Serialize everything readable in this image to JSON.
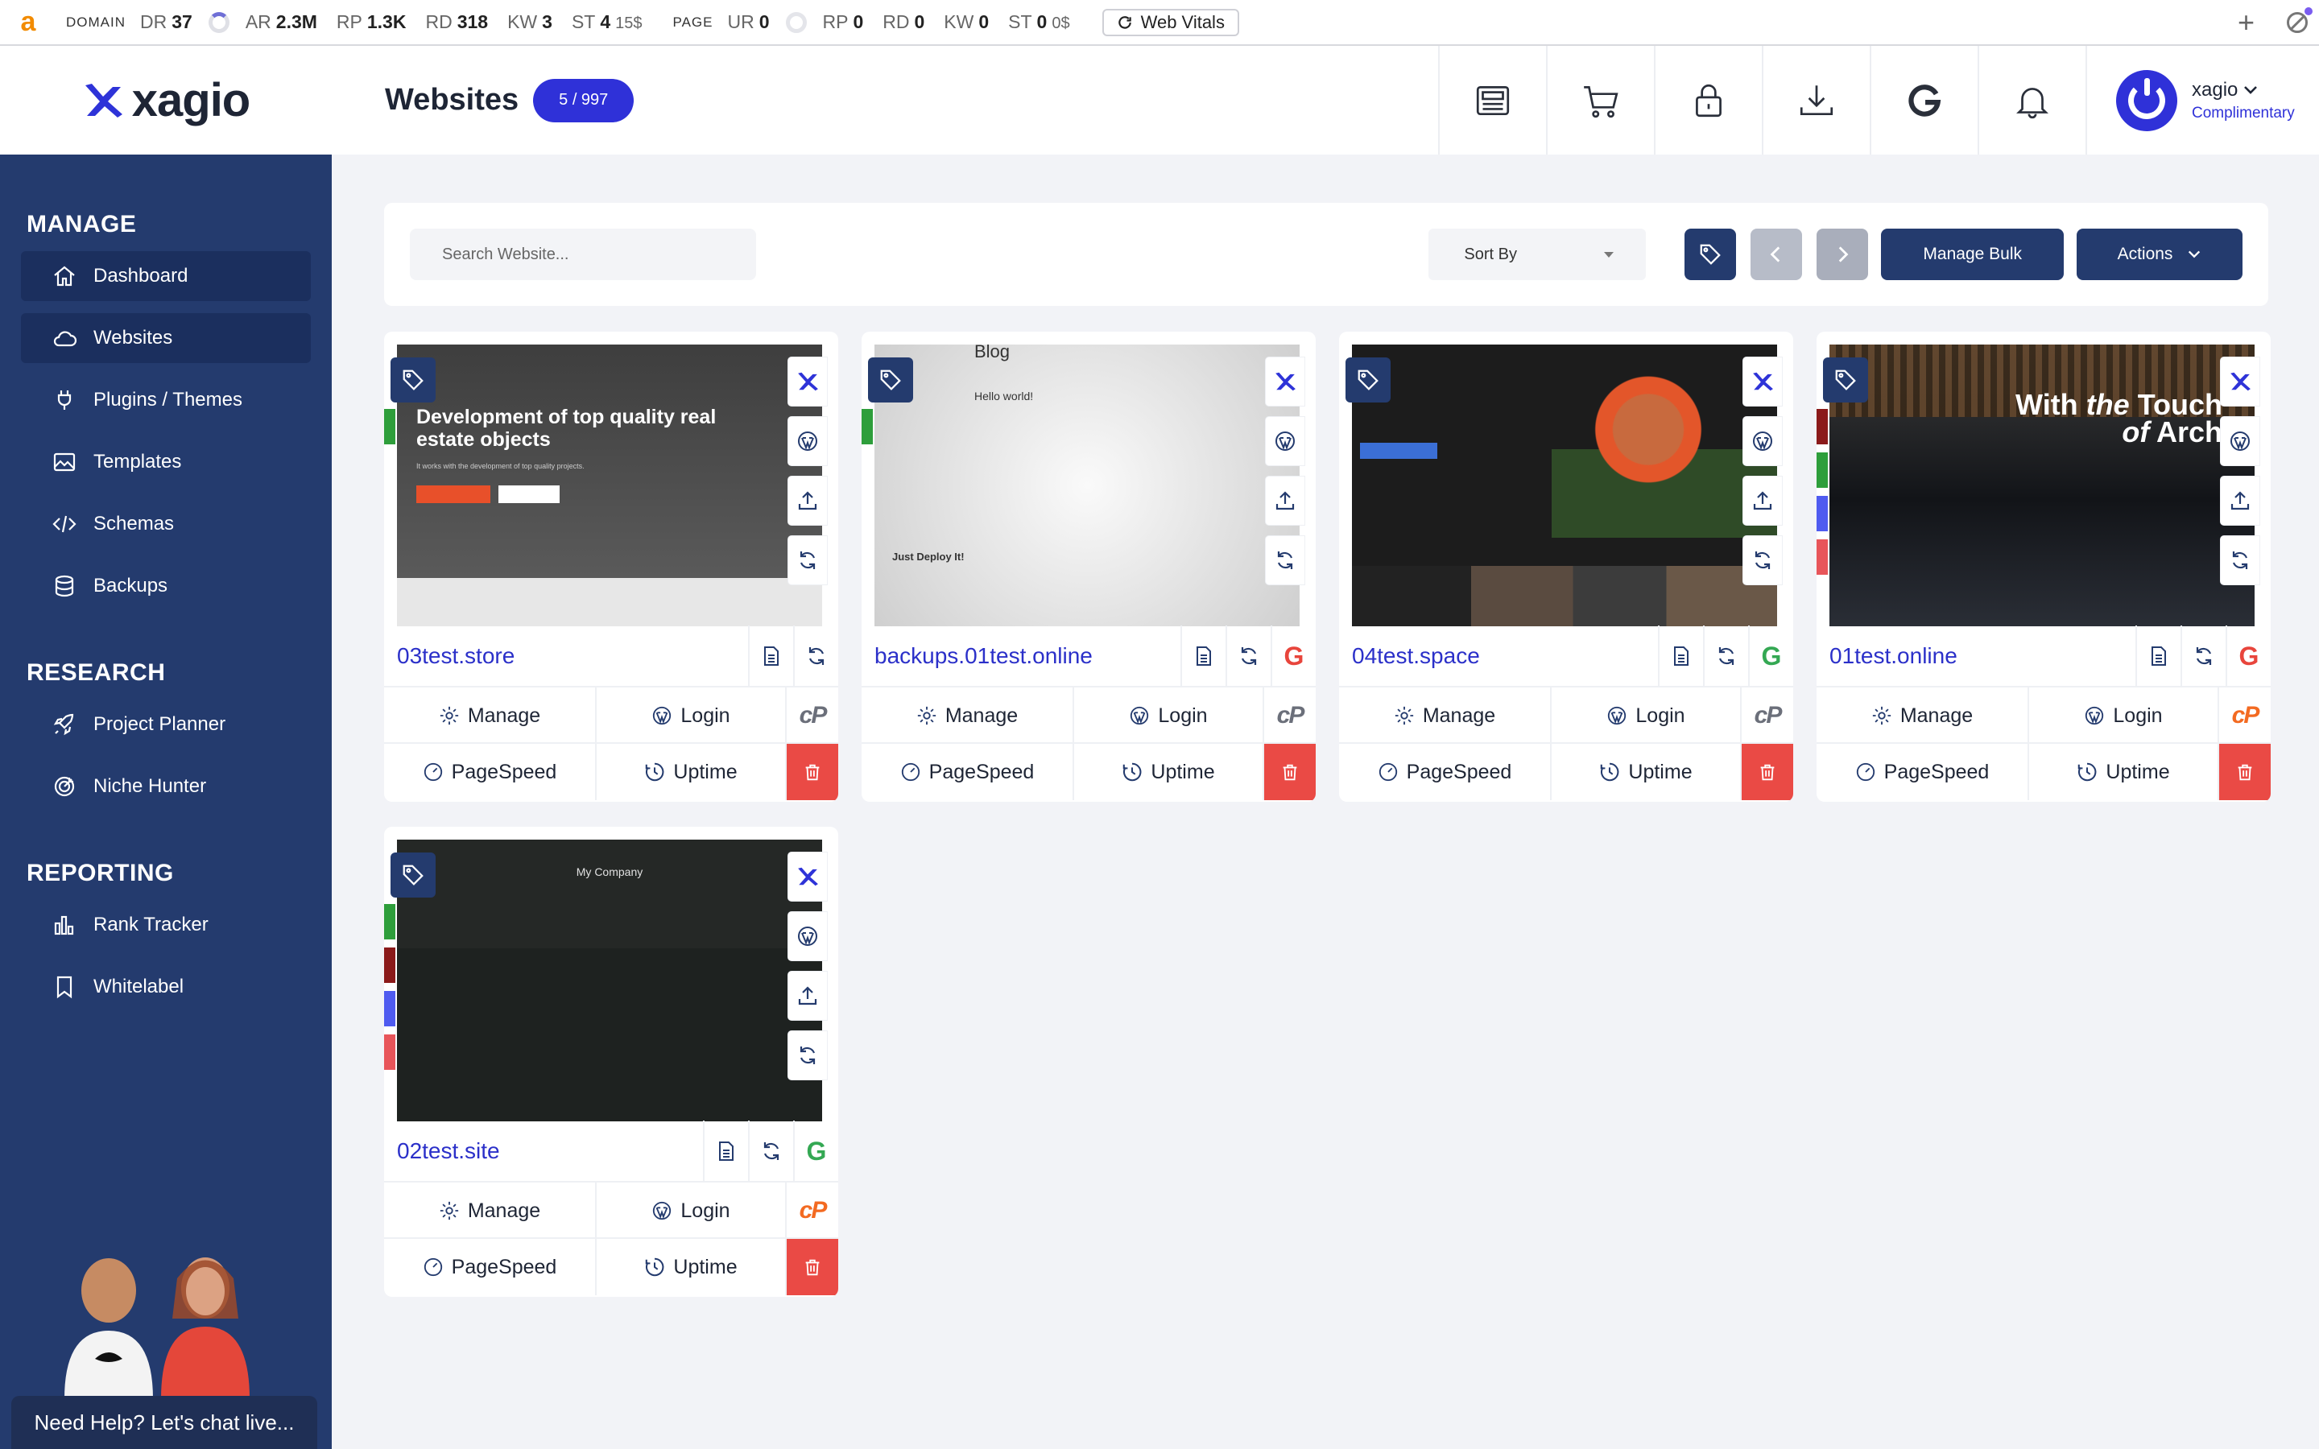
{
  "seo_bar": {
    "logo": "a",
    "domain_label": "DOMAIN",
    "domain_metrics": [
      {
        "k": "DR",
        "v": "37"
      },
      {
        "k": "AR",
        "v": "2.3M"
      },
      {
        "k": "RP",
        "v": "1.3K"
      },
      {
        "k": "RD",
        "v": "318"
      },
      {
        "k": "KW",
        "v": "3"
      },
      {
        "k": "ST",
        "v": "4",
        "u": "15$"
      }
    ],
    "page_label": "PAGE",
    "page_metrics": [
      {
        "k": "UR",
        "v": "0"
      },
      {
        "k": "RP",
        "v": "0"
      },
      {
        "k": "RD",
        "v": "0"
      },
      {
        "k": "KW",
        "v": "0"
      },
      {
        "k": "ST",
        "v": "0",
        "u": "0$"
      }
    ],
    "vitals": "Web Vitals"
  },
  "header": {
    "brand": "xagio",
    "title": "Websites",
    "count": "5 / 997",
    "user_name": "xagio",
    "user_plan": "Complimentary"
  },
  "sidebar": {
    "sections": [
      {
        "title": "MANAGE",
        "items": [
          {
            "label": "Dashboard",
            "icon": "home-icon",
            "active": true
          },
          {
            "label": "Websites",
            "icon": "cloud-icon",
            "active": true
          },
          {
            "label": "Plugins / Themes",
            "icon": "plug-icon"
          },
          {
            "label": "Templates",
            "icon": "image-icon"
          },
          {
            "label": "Schemas",
            "icon": "code-icon"
          },
          {
            "label": "Backups",
            "icon": "database-icon"
          }
        ]
      },
      {
        "title": "RESEARCH",
        "items": [
          {
            "label": "Project Planner",
            "icon": "rocket-icon"
          },
          {
            "label": "Niche Hunter",
            "icon": "target-icon"
          }
        ]
      },
      {
        "title": "REPORTING",
        "items": [
          {
            "label": "Rank Tracker",
            "icon": "bar-chart-icon"
          },
          {
            "label": "Whitelabel",
            "icon": "bookmark-icon"
          }
        ]
      }
    ],
    "chat": "Need Help? Let's chat live..."
  },
  "toolbar": {
    "search_placeholder": "Search Website...",
    "sort": "Sort By",
    "manage_bulk": "Manage Bulk",
    "actions": "Actions"
  },
  "actions": {
    "manage": "Manage",
    "login": "Login",
    "pagespeed": "PageSpeed",
    "uptime": "Uptime"
  },
  "sites": [
    {
      "name": "03test.store",
      "google": "none",
      "cpanel": "grey",
      "strips": [
        "#2e9e3b"
      ]
    },
    {
      "name": "backups.01test.online",
      "google": "red",
      "cpanel": "grey",
      "strips": [
        "#2e9e3b"
      ]
    },
    {
      "name": "04test.space",
      "google": "green",
      "cpanel": "grey",
      "strips": []
    },
    {
      "name": "01test.online",
      "google": "red",
      "cpanel": "orange",
      "strips": [
        "#8b1a1a",
        "#2e9e3b",
        "#4f5bf0",
        "#e8555a"
      ]
    },
    {
      "name": "02test.site",
      "google": "green",
      "cpanel": "orange",
      "strips": [
        "#2e9e3b",
        "#8b1a1a",
        "#4f5bf0",
        "#e8555a"
      ]
    }
  ],
  "thumbs": {
    "t1_heading": "Development of top quality real estate objects",
    "t1_sub": "It works with the development of top quality projects.",
    "t2_blog": "Blog",
    "t2_hello": "Hello world!",
    "t2_deploy": "Just Deploy It!",
    "t4_line1": "With the Touch",
    "t4_line2": "of Arch",
    "t5_company": "My Company"
  },
  "colors": {
    "navy": "#243b6e",
    "blue": "#2f31d8",
    "danger": "#ea4a45",
    "google_red": "#e8453c",
    "google_green": "#34a853",
    "cpanel_orange": "#f36a21"
  }
}
